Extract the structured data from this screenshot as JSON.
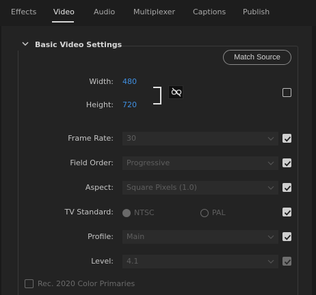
{
  "tabs": [
    {
      "label": "Effects",
      "active": false
    },
    {
      "label": "Video",
      "active": true
    },
    {
      "label": "Audio",
      "active": false
    },
    {
      "label": "Multiplexer",
      "active": false
    },
    {
      "label": "Captions",
      "active": false
    },
    {
      "label": "Publish",
      "active": false
    }
  ],
  "section": {
    "title": "Basic Video Settings",
    "expanded": true,
    "match_source_label": "Match Source"
  },
  "dimensions": {
    "width_label": "Width:",
    "width_value": "480",
    "height_label": "Height:",
    "height_value": "720",
    "link_icon": "unlink-icon",
    "link_checkbox_checked": false
  },
  "fields": {
    "frame_rate": {
      "label": "Frame Rate:",
      "value": "30",
      "checked": true
    },
    "field_order": {
      "label": "Field Order:",
      "value": "Progressive",
      "checked": true
    },
    "aspect": {
      "label": "Aspect:",
      "value": "Square Pixels (1.0)",
      "checked": true
    },
    "tv_standard": {
      "label": "TV Standard:",
      "options": [
        "NTSC",
        "PAL"
      ],
      "selected": "NTSC",
      "checked": true
    },
    "profile": {
      "label": "Profile:",
      "value": "Main",
      "checked": true
    },
    "level": {
      "label": "Level:",
      "value": "4.1",
      "checked": true,
      "checkbox_disabled": true
    }
  },
  "rec2020": {
    "label": "Rec. 2020 Color Primaries",
    "checked": false
  },
  "colors": {
    "accent_blue": "#3f8fe0",
    "background": "#232323",
    "tab_bar": "#1d1d1d"
  }
}
